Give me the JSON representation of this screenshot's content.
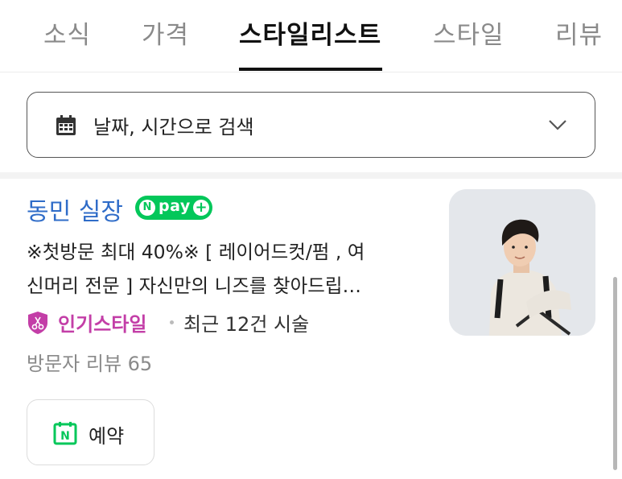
{
  "tabs": [
    {
      "label": "소식",
      "active": false
    },
    {
      "label": "가격",
      "active": false
    },
    {
      "label": "스타일리스트",
      "active": true
    },
    {
      "label": "스타일",
      "active": false
    },
    {
      "label": "리뷰",
      "active": false
    }
  ],
  "date_search": {
    "icon": "calendar-icon",
    "label": "날짜, 시간으로 검색",
    "chevron": "chevron-down-icon"
  },
  "stylist": {
    "name": "동민 실장",
    "pay_badge": {
      "n": "N",
      "text": "pay",
      "plus": "+"
    },
    "description_lines": [
      "※첫방문 최대 40%※ [ 레이어드컷/펌 , 여",
      "신머리 전문 ] 자신만의 니즈를 찾아드립…"
    ],
    "popular_style": "인기스타일",
    "recent": "최근 12건 시술",
    "review": "방문자 리뷰 65",
    "photo_icon": "stylist-photo",
    "reserve": {
      "icon": "naver-booking-icon",
      "icon_letter": "N",
      "label": "예약"
    }
  },
  "colors": {
    "accent_blue": "#2f6cc8",
    "npay_green": "#03c75a",
    "popular_pink": "#c33ea7",
    "active_tab": "#111111",
    "inactive_tab": "#8a8a8a"
  }
}
